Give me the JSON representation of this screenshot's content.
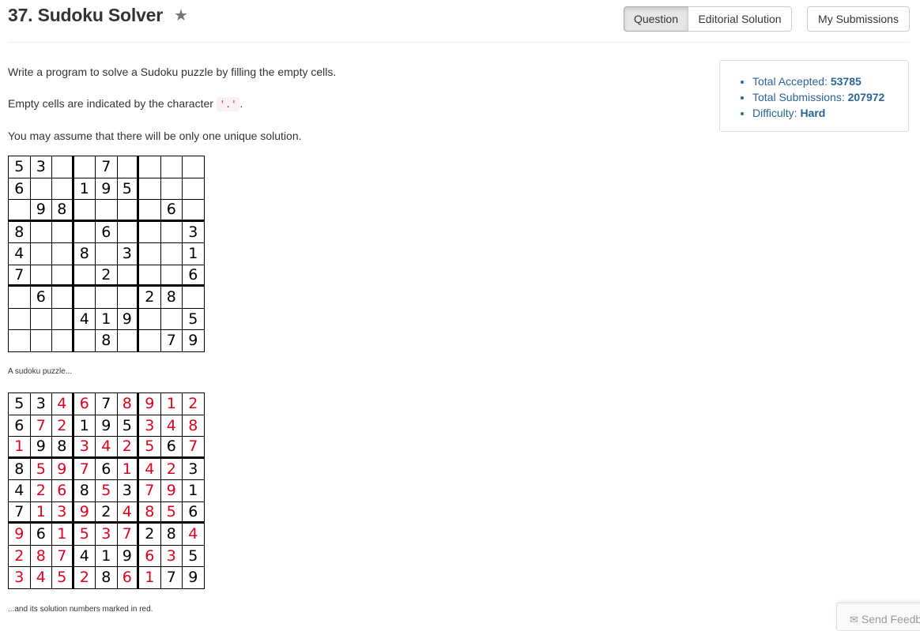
{
  "header": {
    "title": "37. Sudoku Solver",
    "tabs": [
      "Question",
      "Editorial Solution"
    ],
    "submissions_label": "My Submissions"
  },
  "description": {
    "line1": "Write a program to solve a Sudoku puzzle by filling the empty cells.",
    "line2_pre": "Empty cells are indicated by the character",
    "line2_code": "'.'",
    "line2_post": ".",
    "line3": "You may assume that there will be only one unique solution."
  },
  "stats": {
    "accepted_label": "Total Accepted:",
    "accepted_value": "53785",
    "submissions_label": "Total Submissions:",
    "submissions_value": "207972",
    "difficulty_label": "Difficulty:",
    "difficulty_value": "Hard"
  },
  "puzzle": {
    "rows": [
      "53..7....",
      "6..195...",
      ".98....6.",
      "8...6...3",
      "4..8.3..1",
      "7...2...6",
      ".6....28.",
      "...419..5",
      "....8..79"
    ],
    "caption": "A sudoku puzzle..."
  },
  "solution": {
    "rows": [
      "534678912",
      "672195348",
      "198342567",
      "859761423",
      "426853791",
      "713924856",
      "961537284",
      "287419635",
      "345286179"
    ],
    "caption": "...and its solution numbers marked in red."
  },
  "colors": {
    "solution_digit": "#e0001b",
    "given_digit": "#000000",
    "link": "#2a6496"
  },
  "feedback": {
    "label": "Send Feedback",
    "icon": "envelope-icon"
  }
}
